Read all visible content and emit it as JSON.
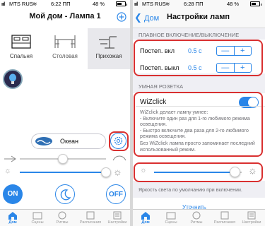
{
  "left": {
    "status": {
      "carrier": "MTS RUS",
      "time": "6:22 ПП",
      "battery": "48 %"
    },
    "title": "Мой дом - Лампа 1",
    "rooms": [
      {
        "label": "Спальня",
        "icon": "bed-icon",
        "active": true
      },
      {
        "label": "Столовая",
        "icon": "dining-table-icon",
        "active": false
      },
      {
        "label": "Прихожая",
        "icon": "floor-lamp-icon",
        "active": false
      }
    ],
    "scene": {
      "label": "Океан",
      "icon": "ocean-scene-icon"
    },
    "temperature_level": 0.5,
    "brightness_level": 0.98,
    "buttons": {
      "on": "ON",
      "off": "OFF"
    }
  },
  "right": {
    "status": {
      "carrier": "MTS RUS",
      "time": "6:28 ПП",
      "battery": "48 %"
    },
    "back_label": "Дом",
    "title": "Настройки ламп",
    "section_fade": "ПЛАВНОЕ ВКЛЮЧЕНИЕ/ВЫКЛЮЧЕНИЕ",
    "fade_on": {
      "label": "Постеп. вкл",
      "value": "0.5 с"
    },
    "fade_off": {
      "label": "Постеп. выкл",
      "value": "0.5 с"
    },
    "stepper": {
      "minus": "—",
      "plus": "+"
    },
    "section_socket": "УМНАЯ РОЗЕТКА",
    "wizclick": {
      "label": "WiZclick",
      "enabled": true
    },
    "desc1": "WiZclick делает лампу умнее:\n- Включите один раз для 1-го любимого режима освещения.\n- Быстро включите два раза для 2-го любимого режима освещения.",
    "desc2": "Без WiZclick лампа просто запоминает последний использованный режим.",
    "default_brightness_level": 0.92,
    "default_brightness_caption": "Яркость света по умолчанию при включении.",
    "cut_text": "Уточнить"
  },
  "tabs": [
    {
      "label": "Дом",
      "icon": "home-icon"
    },
    {
      "label": "Сцены",
      "icon": "scenes-icon"
    },
    {
      "label": "Ритмы",
      "icon": "rhythms-icon"
    },
    {
      "label": "Расписания",
      "icon": "schedules-icon"
    },
    {
      "label": "Настройки",
      "icon": "settings-icon"
    }
  ],
  "colors": {
    "accent": "#2a86e8",
    "highlight": "#d93030"
  }
}
